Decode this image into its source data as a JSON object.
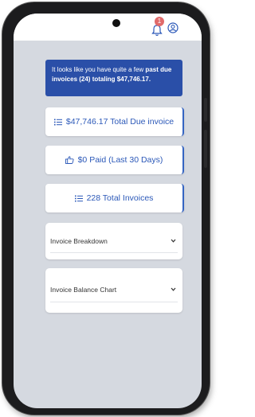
{
  "header": {
    "notification_count": "1"
  },
  "alert": {
    "text_prefix": "It looks like you have quite a few ",
    "bold_text": "past due invoices (24) totaling $47,746.17."
  },
  "cards": {
    "total_due": "$47,746.17 Total Due invoice",
    "paid": "$0 Paid (Last 30 Days)",
    "total_invoices": "228 Total Invoices"
  },
  "sections": {
    "breakdown": "Invoice Breakdown",
    "balance_chart": "Invoice Balance Chart"
  },
  "colors": {
    "accent": "#2b58b8",
    "alert_bg": "#2a4fa8",
    "screen_bg": "#d5d9e0",
    "badge": "#e06a6a"
  },
  "icons": [
    "bell-icon",
    "user-icon",
    "list-icon",
    "thumbs-up-icon",
    "chevron-down-icon"
  ]
}
